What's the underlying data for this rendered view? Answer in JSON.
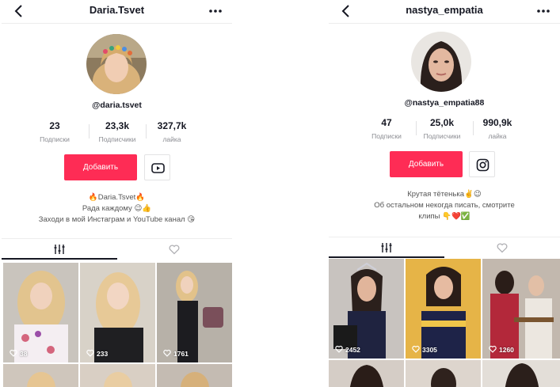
{
  "profiles": [
    {
      "title": "Daria.Tsvet",
      "username": "@daria.tsvet",
      "stats": [
        {
          "value": "23",
          "label": "Подписки"
        },
        {
          "value": "23,3k",
          "label": "Подписчики"
        },
        {
          "value": "327,7k",
          "label": "лайка"
        }
      ],
      "follow_label": "Добавить",
      "social_icon": "youtube-icon",
      "bio": [
        "🔥Daria.Tsvet🔥",
        "Рада каждому 😉👍",
        "Заходи в мой Инстаграм и YouTube канал 😘"
      ],
      "tabs": [
        "videos-tab-icon",
        "liked-tab-icon"
      ],
      "videos": [
        {
          "likes": "38"
        },
        {
          "likes": "233"
        },
        {
          "likes": "1761"
        }
      ]
    },
    {
      "title": "nastya_empatia",
      "username": "@nastya_empatia88",
      "stats": [
        {
          "value": "47",
          "label": "Подписки"
        },
        {
          "value": "25,0k",
          "label": "Подписчики"
        },
        {
          "value": "990,9k",
          "label": "лайка"
        }
      ],
      "follow_label": "Добавить",
      "social_icon": "instagram-icon",
      "bio": [
        "Крутая тётенька✌️😉",
        "Об остальном некогда писать, смотрите",
        "клипы 👇❤️✅"
      ],
      "tabs": [
        "videos-tab-icon",
        "liked-tab-icon"
      ],
      "videos": [
        {
          "likes": "2452"
        },
        {
          "likes": "3305"
        },
        {
          "likes": "1260"
        }
      ]
    }
  ],
  "colors": {
    "accent": "#fe2c55",
    "text": "#161823",
    "muted": "#8a8b91"
  }
}
